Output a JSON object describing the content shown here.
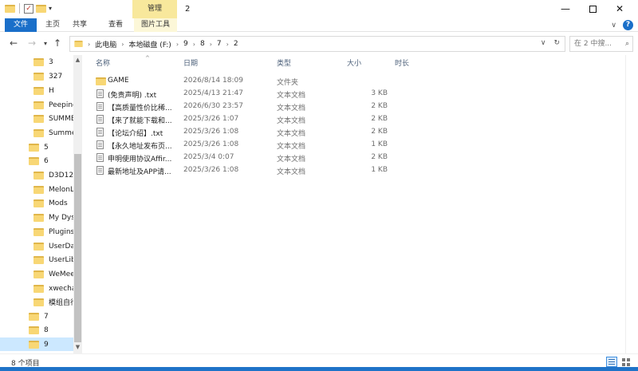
{
  "window": {
    "title": "2",
    "manage_tab": "管理",
    "minimize": "—",
    "close": "✕"
  },
  "ribbon": {
    "tabs": [
      {
        "label": "文件"
      },
      {
        "label": "主页"
      },
      {
        "label": "共享"
      },
      {
        "label": "查看"
      },
      {
        "label": "图片工具"
      }
    ],
    "help": "?",
    "expand": "∨"
  },
  "address": {
    "back": "←",
    "forward": "→",
    "up": "↑",
    "crumbs": [
      "此电脑",
      "本地磁盘 (F:)",
      "9",
      "8",
      "7",
      "2"
    ],
    "dropdown": "∨",
    "refresh": "↻"
  },
  "search": {
    "placeholder": "在 2 中搜..."
  },
  "nav_pane": {
    "items": [
      {
        "label": "3"
      },
      {
        "label": "327"
      },
      {
        "label": "H"
      },
      {
        "label": "Peeping"
      },
      {
        "label": "SUMME"
      },
      {
        "label": "Summer"
      },
      {
        "label": "5"
      },
      {
        "label": "6"
      },
      {
        "label": "D3D12"
      },
      {
        "label": "MelonLo"
      },
      {
        "label": "Mods"
      },
      {
        "label": "My Dyst"
      },
      {
        "label": "Plugins"
      },
      {
        "label": "UserDat"
      },
      {
        "label": "UserLibs"
      },
      {
        "label": "WeMeet"
      },
      {
        "label": "xwechat"
      },
      {
        "label": "模组自行"
      },
      {
        "label": "7"
      },
      {
        "label": "8"
      },
      {
        "label": "9"
      }
    ]
  },
  "columns": {
    "name": "名称",
    "date": "日期",
    "type": "类型",
    "size": "大小",
    "duration": "时长"
  },
  "files": [
    {
      "name": "GAME",
      "date": "2026/8/14 18:09",
      "type": "文件夹",
      "size": "",
      "kind": "folder"
    },
    {
      "name": "(免责声明) .txt",
      "date": "2025/4/13 21:47",
      "type": "文本文档",
      "size": "3 KB",
      "kind": "file"
    },
    {
      "name": "【高质量性价比稀...",
      "date": "2026/6/30 23:57",
      "type": "文本文档",
      "size": "2 KB",
      "kind": "file"
    },
    {
      "name": "【来了就能下载和...",
      "date": "2025/3/26 1:07",
      "type": "文本文档",
      "size": "2 KB",
      "kind": "file"
    },
    {
      "name": "【论坛介绍】.txt",
      "date": "2025/3/26 1:08",
      "type": "文本文档",
      "size": "2 KB",
      "kind": "file"
    },
    {
      "name": "【永久地址发布页...",
      "date": "2025/3/26 1:08",
      "type": "文本文档",
      "size": "1 KB",
      "kind": "file"
    },
    {
      "name": "申明使用协议Affir...",
      "date": "2025/3/4 0:07",
      "type": "文本文档",
      "size": "2 KB",
      "kind": "file"
    },
    {
      "name": "最新地址及APP请...",
      "date": "2025/3/26 1:08",
      "type": "文本文档",
      "size": "1 KB",
      "kind": "file"
    }
  ],
  "status": {
    "item_count": "8 个项目"
  }
}
